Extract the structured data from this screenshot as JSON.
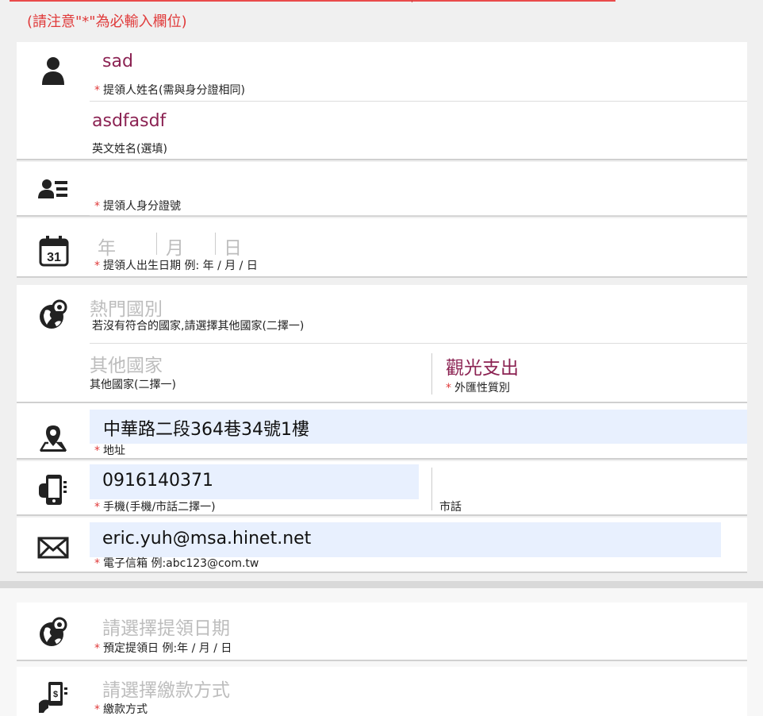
{
  "notice": "(請注意\"*\"為必輸入欄位)",
  "name": {
    "value": "sad",
    "label": "提領人姓名(需與身分證相同)",
    "required": "*"
  },
  "english_name": {
    "value": "asdfasdf",
    "label": "英文姓名(選填)"
  },
  "id_number": {
    "label": "提領人身分證號",
    "required": "*"
  },
  "birth_date": {
    "year_ph": "年",
    "month_ph": "月",
    "day_ph": "日",
    "label": "提領人出生日期 例: 年 / 月 / 日",
    "required": "*",
    "calendar_day": "31"
  },
  "popular_country": {
    "placeholder": "熱門國別",
    "label": "若沒有符合的國家,請選擇其他國家(二擇一)"
  },
  "other_country": {
    "placeholder": "其他國家",
    "label": "其他國家(二擇一)"
  },
  "exchange_type": {
    "value": "觀光支出",
    "label": "外匯性質別",
    "required": "*"
  },
  "address": {
    "value": "中華路二段364巷34號1樓",
    "label": "地址",
    "required": "*"
  },
  "mobile": {
    "value": "0916140371",
    "label": "手機(手機/市話二擇一)",
    "required": "*"
  },
  "landline": {
    "label": "市話"
  },
  "email": {
    "value": "eric.yuh@msa.hinet.net",
    "label": "電子信箱 例:abc123@com.tw",
    "required": "*"
  },
  "pickup_date": {
    "placeholder": "請選擇提領日期",
    "label": "預定提領日 例:年 / 月 / 日",
    "required": "*"
  },
  "payment": {
    "placeholder": "請選擇繳款方式",
    "label": "繳款方式",
    "required": "*"
  },
  "icons": [
    "person-icon",
    "id-card-icon",
    "calendar-icon",
    "globe-pin-icon",
    "map-pin-icon",
    "mobile-phone-icon",
    "envelope-icon",
    "globe-pin-icon",
    "payment-phone-icon"
  ]
}
